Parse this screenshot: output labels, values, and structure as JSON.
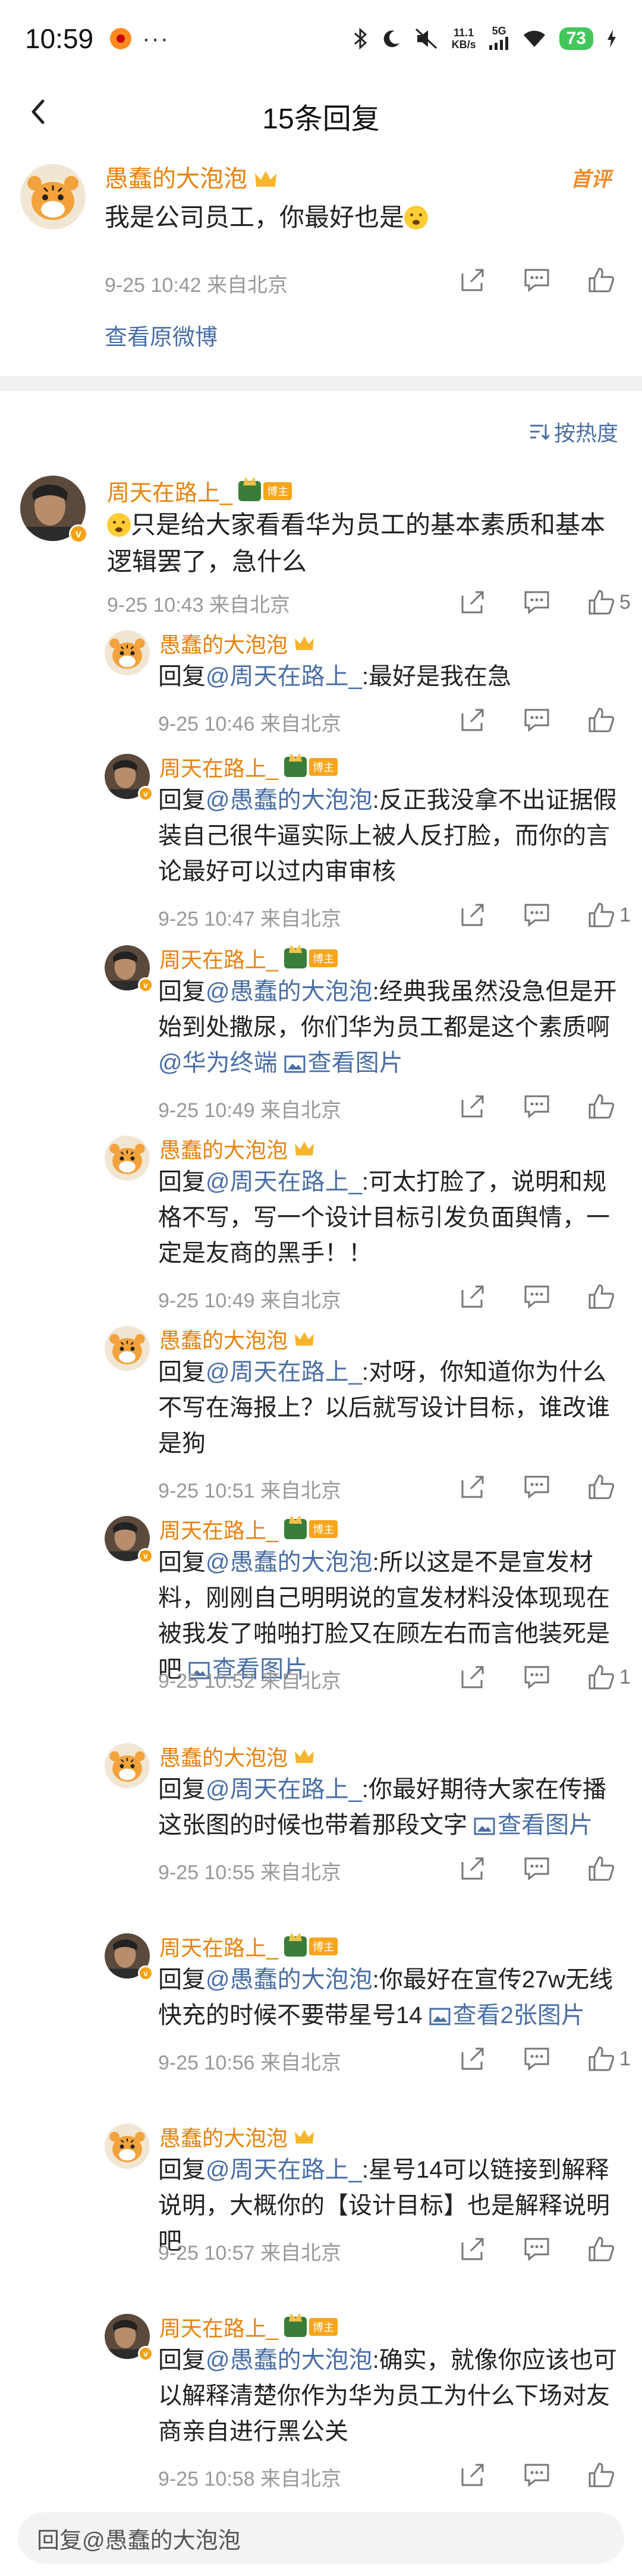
{
  "status": {
    "time": "10:59",
    "more": "···",
    "net_speed": "11.1",
    "net_unit": "KB/s",
    "net_type": "5G",
    "battery": "73"
  },
  "nav": {
    "title": "15条回复"
  },
  "original": {
    "author": "愚蠢的大泡泡",
    "text": "我是公司员工，你最好也是",
    "badge": "首评",
    "meta": "9-25 10:42  来自北京",
    "view_link": "查看原微博"
  },
  "sort": {
    "label": "按热度"
  },
  "main_comment": {
    "author": "周天在路上_",
    "badge": "博主",
    "text": "只是给大家看看华为员工的基本素质和基本逻辑罢了，急什么",
    "meta": "9-25 10:43  来自北京",
    "likes": "5"
  },
  "replies": [
    {
      "author": "愚蠢的大泡泡",
      "prefix": "回复",
      "mention": "@周天在路上_",
      "text": ":最好是我在急",
      "link": "",
      "meta": "9-25 10:46  来自北京",
      "likes": ""
    },
    {
      "author": "周天在路上_",
      "prefix": "回复",
      "mention": "@愚蠢的大泡泡",
      "text": ":反正我没拿不出证据假装自己很牛逼实际上被人反打脸，而你的言论最好可以过内审审核",
      "link": "",
      "meta": "9-25 10:47  来自北京",
      "likes": "1"
    },
    {
      "author": "周天在路上_",
      "prefix": "回复",
      "mention": "@愚蠢的大泡泡",
      "text": ":经典我虽然没急但是开始到处撒尿，你们华为员工都是这个素质啊",
      "mention2": "@华为终端",
      "link": "查看图片",
      "meta": "9-25 10:49  来自北京",
      "likes": ""
    },
    {
      "author": "愚蠢的大泡泡",
      "prefix": "回复",
      "mention": "@周天在路上_",
      "text": ":可太打脸了，说明和规格不写，写一个设计目标引发负面舆情，一定是友商的黑手！！",
      "link": "",
      "meta": "9-25 10:49  来自北京",
      "likes": ""
    },
    {
      "author": "愚蠢的大泡泡",
      "prefix": "回复",
      "mention": "@周天在路上_",
      "text": ":对呀，你知道你为什么不写在海报上？以后就写设计目标，谁改谁是狗",
      "link": "",
      "meta": "9-25 10:51  来自北京",
      "likes": ""
    },
    {
      "author": "周天在路上_",
      "prefix": "回复",
      "mention": "@愚蠢的大泡泡",
      "text": ":所以这是不是宣发材料，刚刚自己明明说的宣发材料没体现现在被我发了啪啪打脸又在顾左右而言他装死是吧",
      "link": "查看图片",
      "meta": "9-25 10:52  来自北京",
      "likes": "1"
    },
    {
      "author": "愚蠢的大泡泡",
      "prefix": "回复",
      "mention": "@周天在路上_",
      "text": ":你最好期待大家在传播这张图的时候也带着那段文字",
      "link": "查看图片",
      "meta": "9-25 10:55  来自北京",
      "likes": ""
    },
    {
      "author": "周天在路上_",
      "prefix": "回复",
      "mention": "@愚蠢的大泡泡",
      "text": ":你最好在宣传27w无线快充的时候不要带星号14",
      "link": "查看2张图片",
      "meta": "9-25 10:56  来自北京",
      "likes": "1"
    },
    {
      "author": "愚蠢的大泡泡",
      "prefix": "回复",
      "mention": "@周天在路上_",
      "text": ":星号14可以链接到解释说明，大概你的【设计目标】也是解释说明吧",
      "link": "",
      "meta": "9-25 10:57  来自北京",
      "likes": ""
    },
    {
      "author": "周天在路上_",
      "prefix": "回复",
      "mention": "@愚蠢的大泡泡",
      "text": ":确实，就像你应该也可以解释清楚你作为华为员工为什么下场对友商亲自进行黑公关",
      "link": "",
      "meta": "9-25 10:58  来自北京",
      "likes": ""
    }
  ],
  "input": {
    "placeholder": "回复@愚蠢的大泡泡"
  },
  "colors": {
    "name": "#e8820c",
    "link": "#4a6fa5",
    "meta": "#999999"
  }
}
